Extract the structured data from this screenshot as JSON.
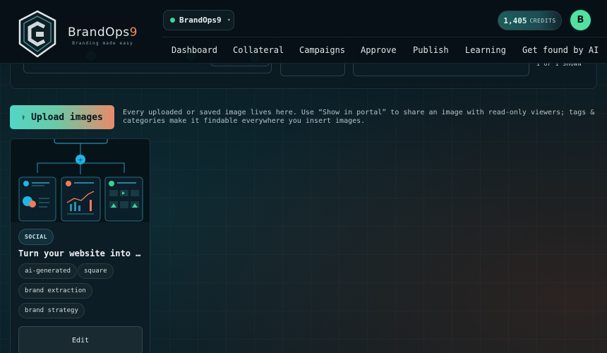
{
  "brand": {
    "name": "BrandOps",
    "name_suffix": "9",
    "tagline": "Branding made easy"
  },
  "workspace": {
    "name": "BrandOps9",
    "caret_icon": "chevron-down-icon",
    "status_color": "#3ed598"
  },
  "credits": {
    "amount": "1,405",
    "label": "CREDITS"
  },
  "user": {
    "initial": "B"
  },
  "nav": {
    "items": [
      "Dashboard",
      "Collateral",
      "Campaigns",
      "Approve",
      "Publish",
      "Learning",
      "Get found by AI"
    ]
  },
  "filters": {
    "shown_text": "1 OF 1 SHOWN"
  },
  "upload": {
    "button_label": "Upload images",
    "icon": "upload-icon",
    "description": "Every uploaded or saved image lives here. Use “Show in portal” to share an image with read-only viewers; tags & categories make it findable everywhere you insert images."
  },
  "gallery": {
    "items": [
      {
        "category": "SOCIAL",
        "title": "Turn your website into a brand kit",
        "tags": [
          "ai-generated",
          "square",
          "brand extraction",
          "brand strategy"
        ],
        "edit_label": "Edit"
      }
    ]
  },
  "colors": {
    "accent_teal": "#52d6c6",
    "accent_orange": "#e98a6a",
    "avatar_green": "#54e0a0",
    "background": "#08151c"
  }
}
